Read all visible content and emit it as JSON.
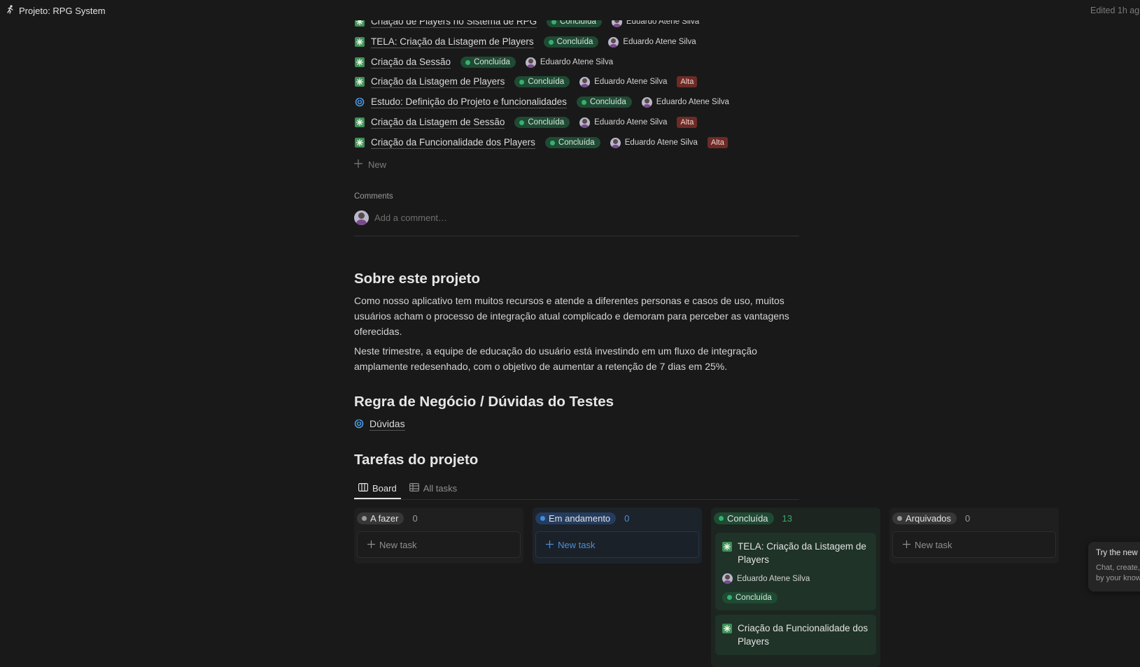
{
  "topbar": {
    "page_title": "Projeto: RPG System",
    "edited": "Edited 1h ag"
  },
  "tasks": [
    {
      "name": "Criação de Players no Sistema de RPG",
      "status": "Concluída",
      "assignee": "Eduardo Atene Silva",
      "priority": "",
      "icon": "bug-icon"
    },
    {
      "name": "TELA: Criação da Listagem de Players",
      "status": "Concluída",
      "assignee": "Eduardo Atene Silva",
      "priority": "",
      "icon": "bug-icon"
    },
    {
      "name": "Criação da Sessão",
      "status": "Concluída",
      "assignee": "Eduardo Atene Silva",
      "priority": "",
      "icon": "bug-icon"
    },
    {
      "name": "Criação da Listagem de Players",
      "status": "Concluída",
      "assignee": "Eduardo Atene Silva",
      "priority": "Alta",
      "icon": "bug-icon"
    },
    {
      "name": "Estudo: Definição do Projeto e funcionalidades",
      "status": "Concluída",
      "assignee": "Eduardo Atene Silva",
      "priority": "",
      "icon": "study-icon"
    },
    {
      "name": "Criação da Listagem de Sessão",
      "status": "Concluída",
      "assignee": "Eduardo Atene Silva",
      "priority": "Alta",
      "icon": "bug-icon"
    },
    {
      "name": "Criação da Funcionalidade dos Players",
      "status": "Concluída",
      "assignee": "Eduardo Atene Silva",
      "priority": "Alta",
      "icon": "bug-icon"
    }
  ],
  "new_row_label": "New",
  "comments": {
    "label": "Comments",
    "placeholder": "Add a comment…"
  },
  "about": {
    "heading": "Sobre este projeto",
    "p1": "Como nosso aplicativo tem muitos recursos e atende a diferentes personas e casos de uso, muitos usuários acham o processo de integração atual complicado e demoram para perceber as vantagens oferecidas.",
    "p2": "Neste trimestre, a equipe de educação do usuário está investindo em um fluxo de integração amplamente redesenhado, com o objetivo de aumentar a retenção de 7 dias em 25%."
  },
  "rules": {
    "heading": "Regra de Negócio / Dúvidas do Testes",
    "link": "Dúvidas"
  },
  "tarefas": {
    "heading": "Tarefas do projeto",
    "tabs": [
      "Board",
      "All tasks"
    ]
  },
  "board": {
    "columns": [
      {
        "label": "A fazer",
        "count": "0",
        "new_task": "New task"
      },
      {
        "label": "Em andamento",
        "count": "0",
        "new_task": "New task"
      },
      {
        "label": "Concluída",
        "count": "13",
        "new_task": ""
      },
      {
        "label": "Arquivados",
        "count": "0",
        "new_task": "New task"
      }
    ],
    "cards": [
      {
        "title": "TELA: Criação da Listagem de Players",
        "assignee": "Eduardo Atene Silva",
        "status": "Concluída"
      },
      {
        "title": "Criação da Funcionalidade dos Players",
        "assignee": "",
        "status": ""
      }
    ]
  },
  "tooltip": {
    "title": "Try the new N",
    "line1": "Chat, create,",
    "line2": "by your know"
  },
  "colors": {
    "background": "#191919",
    "done_green": "#1f4a33",
    "alta_red": "#6e2b26",
    "blue": "#2f6bbf"
  }
}
